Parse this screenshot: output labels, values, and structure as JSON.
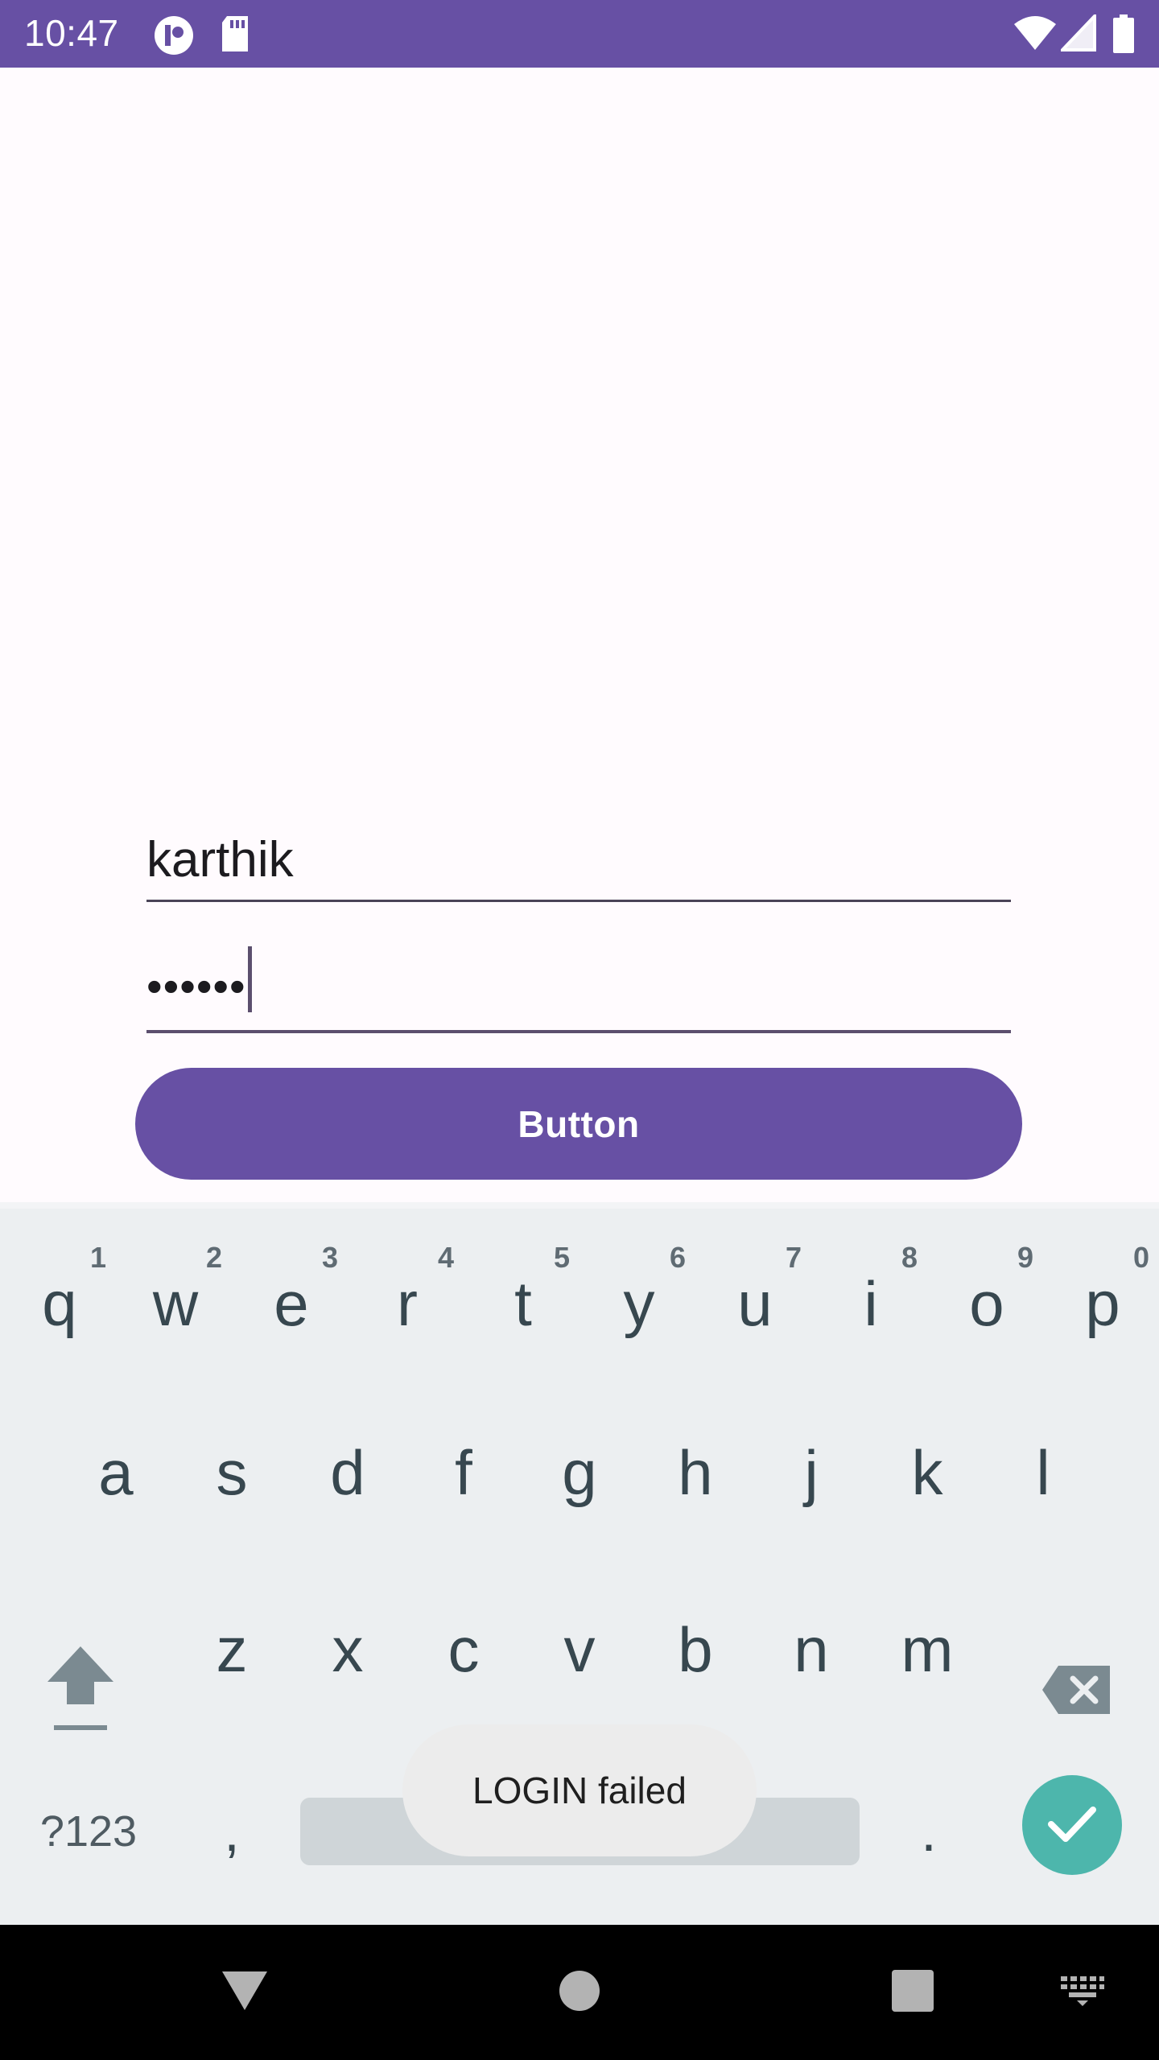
{
  "status_bar": {
    "time": "10:47",
    "icons": [
      "circle-app-icon",
      "sd-card-icon",
      "wifi-icon",
      "signal-icon",
      "battery-icon"
    ],
    "background": "#6750a4"
  },
  "form": {
    "username_value": "karthik",
    "password_value": "••••••",
    "button_label": "Button",
    "accent": "#6750a4"
  },
  "keyboard": {
    "row1": [
      {
        "key": "q",
        "hint": "1"
      },
      {
        "key": "w",
        "hint": "2"
      },
      {
        "key": "e",
        "hint": "3"
      },
      {
        "key": "r",
        "hint": "4"
      },
      {
        "key": "t",
        "hint": "5"
      },
      {
        "key": "y",
        "hint": "6"
      },
      {
        "key": "u",
        "hint": "7"
      },
      {
        "key": "i",
        "hint": "8"
      },
      {
        "key": "o",
        "hint": "9"
      },
      {
        "key": "p",
        "hint": "0"
      }
    ],
    "row2": [
      "a",
      "s",
      "d",
      "f",
      "g",
      "h",
      "j",
      "k",
      "l"
    ],
    "row3": [
      "z",
      "x",
      "c",
      "v",
      "b",
      "n",
      "m"
    ],
    "symbols_label": "?123",
    "comma_label": ",",
    "period_label": ".",
    "shift_icon": "shift-icon",
    "backspace_icon": "backspace-icon",
    "enter_icon": "check-icon",
    "enter_color": "#4db6ac"
  },
  "toast": {
    "message": "LOGIN failed"
  },
  "nav_bar": {
    "icons": [
      "back-icon",
      "home-icon",
      "recents-icon",
      "keyboard-switch-icon"
    ]
  }
}
